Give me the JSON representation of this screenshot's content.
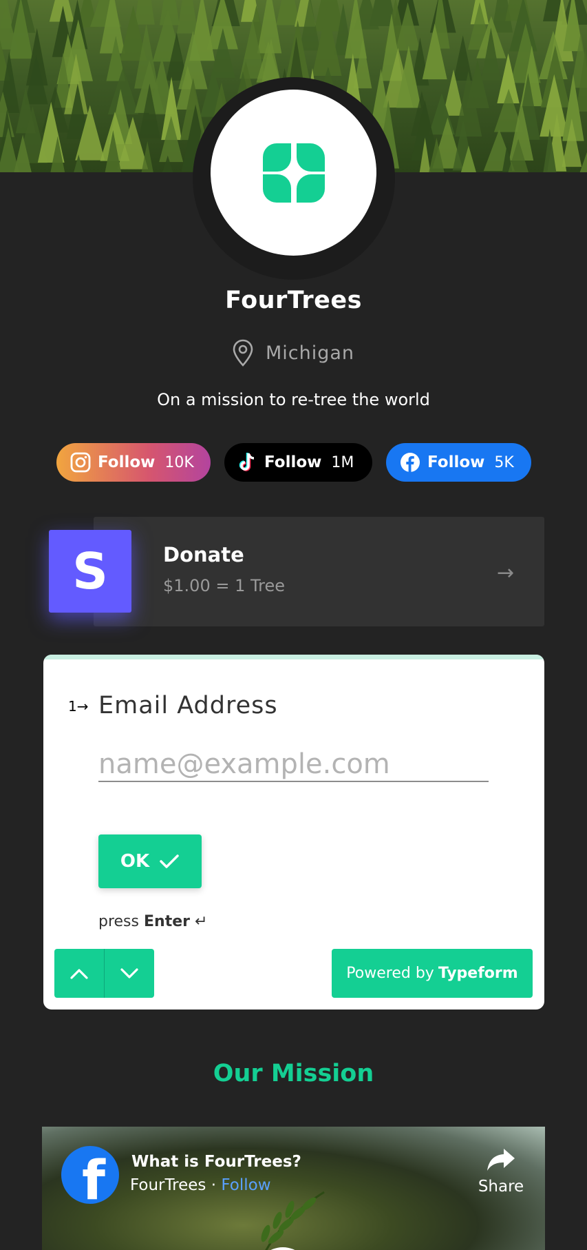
{
  "profile": {
    "name": "FourTrees",
    "location": "Michigan",
    "tagline": "On a mission to re-tree the world"
  },
  "socials": [
    {
      "platform": "instagram",
      "label": "Follow",
      "count": "10K",
      "icon": "instagram-icon"
    },
    {
      "platform": "tiktok",
      "label": "Follow",
      "count": "1M",
      "icon": "tiktok-icon"
    },
    {
      "platform": "facebook",
      "label": "Follow",
      "count": "5K",
      "icon": "facebook-icon"
    }
  ],
  "donate": {
    "logo_letter": "S",
    "title": "Donate",
    "subtitle": "$1.00 = 1 Tree",
    "arrow": "→"
  },
  "typeform": {
    "question_number": "1",
    "question_arrow": "→",
    "label": "Email Address",
    "placeholder": "name@example.com",
    "value": "",
    "ok_label": "OK",
    "press_text": "press",
    "press_key": "Enter",
    "press_symbol": "↵",
    "powered_by": "Powered by",
    "brand": "Typeform"
  },
  "mission": {
    "heading": "Our Mission"
  },
  "video": {
    "title": "What is FourTrees?",
    "channel": "FourTrees",
    "separator": "·",
    "follow_label": "Follow",
    "share_label": "Share"
  },
  "colors": {
    "background": "#232323",
    "accent_green": "#14cf93",
    "stripe_purple": "#635bff",
    "facebook_blue": "#1877f2"
  }
}
